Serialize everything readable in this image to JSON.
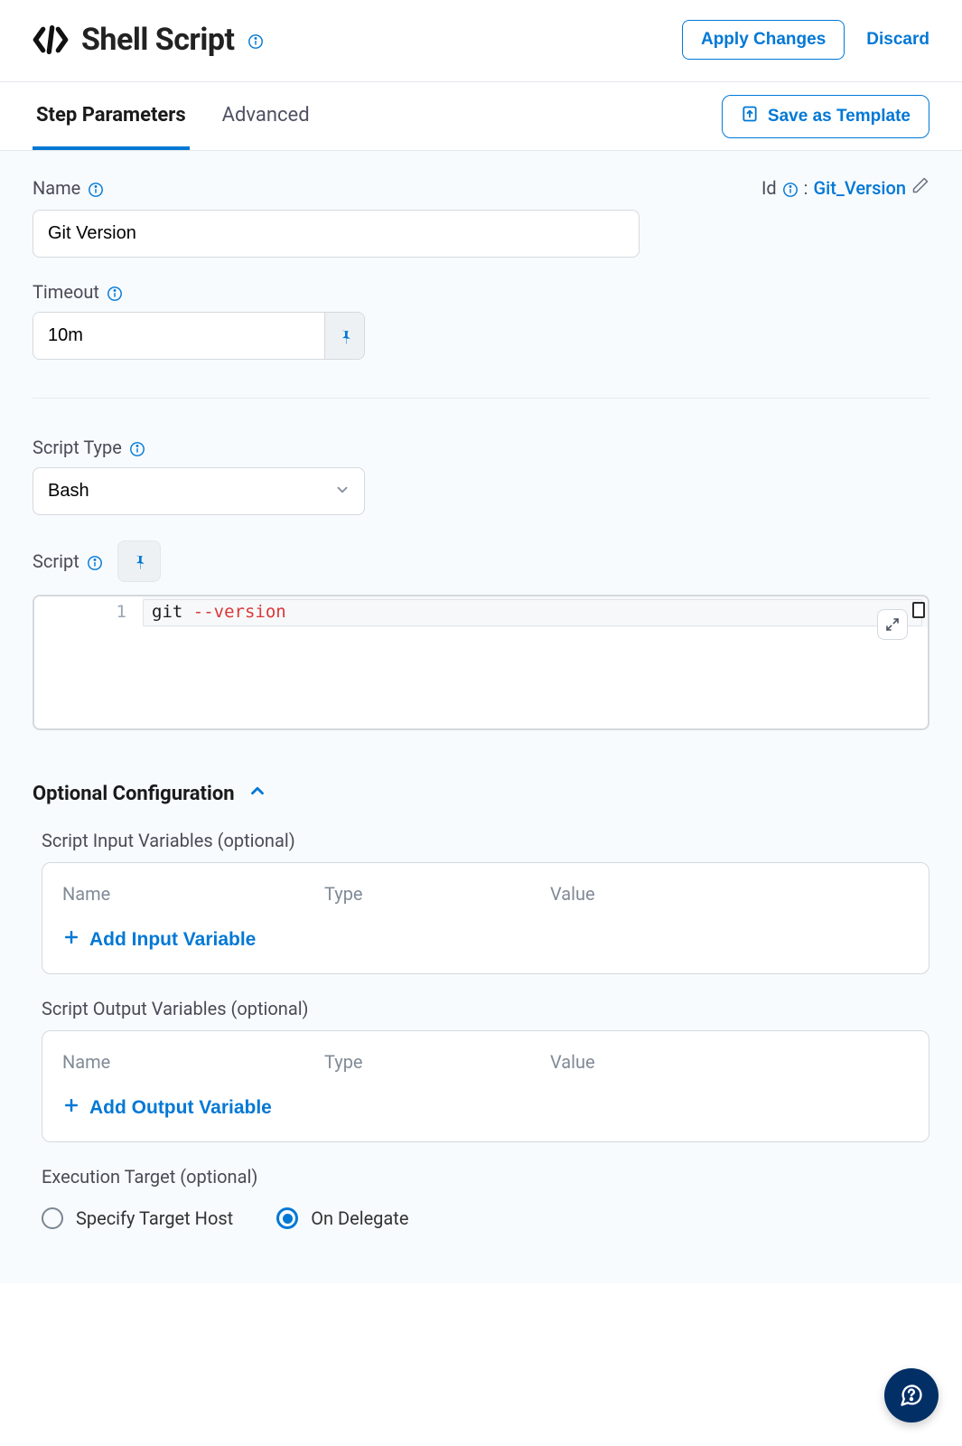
{
  "header": {
    "title": "Shell Script",
    "apply_label": "Apply Changes",
    "discard_label": "Discard"
  },
  "tabs": {
    "step_parameters": "Step Parameters",
    "advanced": "Advanced",
    "save_template": "Save as Template"
  },
  "fields": {
    "name_label": "Name",
    "name_value": "Git Version",
    "id_label": "Id",
    "id_value": "Git_Version",
    "timeout_label": "Timeout",
    "timeout_value": "10m",
    "script_type_label": "Script Type",
    "script_type_value": "Bash",
    "script_label": "Script",
    "script_line_no": "1",
    "script_cmd": "git",
    "script_arg": "--version"
  },
  "optional": {
    "section_title": "Optional Configuration",
    "input_vars_label": "Script Input Variables (optional)",
    "output_vars_label": "Script Output Variables (optional)",
    "col_name": "Name",
    "col_type": "Type",
    "col_value": "Value",
    "add_input_label": "Add Input Variable",
    "add_output_label": "Add Output Variable",
    "exec_target_label": "Execution Target (optional)",
    "radio_specify": "Specify Target Host",
    "radio_delegate": "On Delegate"
  }
}
